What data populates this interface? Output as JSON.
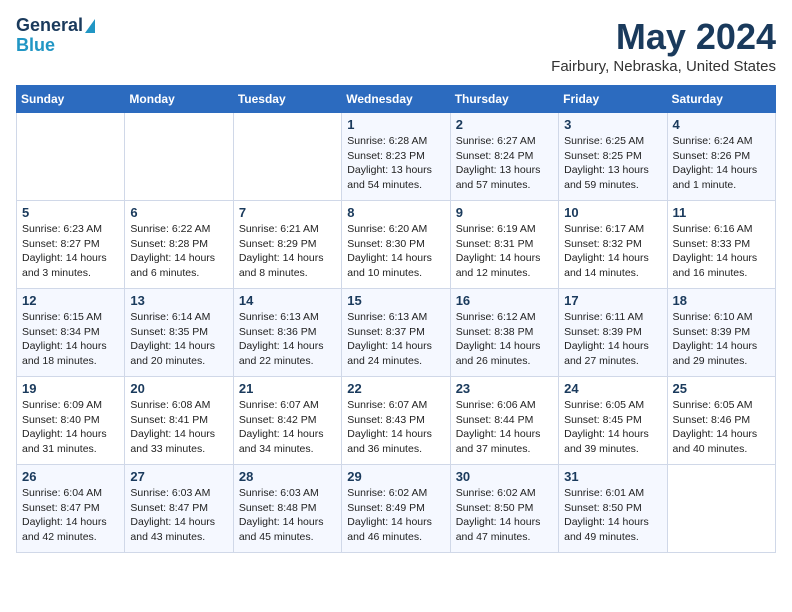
{
  "header": {
    "logo_line1": "General",
    "logo_line2": "Blue",
    "month": "May 2024",
    "location": "Fairbury, Nebraska, United States"
  },
  "weekdays": [
    "Sunday",
    "Monday",
    "Tuesday",
    "Wednesday",
    "Thursday",
    "Friday",
    "Saturday"
  ],
  "weeks": [
    [
      {
        "day": "",
        "info": ""
      },
      {
        "day": "",
        "info": ""
      },
      {
        "day": "",
        "info": ""
      },
      {
        "day": "1",
        "info": "Sunrise: 6:28 AM\nSunset: 8:23 PM\nDaylight: 13 hours\nand 54 minutes."
      },
      {
        "day": "2",
        "info": "Sunrise: 6:27 AM\nSunset: 8:24 PM\nDaylight: 13 hours\nand 57 minutes."
      },
      {
        "day": "3",
        "info": "Sunrise: 6:25 AM\nSunset: 8:25 PM\nDaylight: 13 hours\nand 59 minutes."
      },
      {
        "day": "4",
        "info": "Sunrise: 6:24 AM\nSunset: 8:26 PM\nDaylight: 14 hours\nand 1 minute."
      }
    ],
    [
      {
        "day": "5",
        "info": "Sunrise: 6:23 AM\nSunset: 8:27 PM\nDaylight: 14 hours\nand 3 minutes."
      },
      {
        "day": "6",
        "info": "Sunrise: 6:22 AM\nSunset: 8:28 PM\nDaylight: 14 hours\nand 6 minutes."
      },
      {
        "day": "7",
        "info": "Sunrise: 6:21 AM\nSunset: 8:29 PM\nDaylight: 14 hours\nand 8 minutes."
      },
      {
        "day": "8",
        "info": "Sunrise: 6:20 AM\nSunset: 8:30 PM\nDaylight: 14 hours\nand 10 minutes."
      },
      {
        "day": "9",
        "info": "Sunrise: 6:19 AM\nSunset: 8:31 PM\nDaylight: 14 hours\nand 12 minutes."
      },
      {
        "day": "10",
        "info": "Sunrise: 6:17 AM\nSunset: 8:32 PM\nDaylight: 14 hours\nand 14 minutes."
      },
      {
        "day": "11",
        "info": "Sunrise: 6:16 AM\nSunset: 8:33 PM\nDaylight: 14 hours\nand 16 minutes."
      }
    ],
    [
      {
        "day": "12",
        "info": "Sunrise: 6:15 AM\nSunset: 8:34 PM\nDaylight: 14 hours\nand 18 minutes."
      },
      {
        "day": "13",
        "info": "Sunrise: 6:14 AM\nSunset: 8:35 PM\nDaylight: 14 hours\nand 20 minutes."
      },
      {
        "day": "14",
        "info": "Sunrise: 6:13 AM\nSunset: 8:36 PM\nDaylight: 14 hours\nand 22 minutes."
      },
      {
        "day": "15",
        "info": "Sunrise: 6:13 AM\nSunset: 8:37 PM\nDaylight: 14 hours\nand 24 minutes."
      },
      {
        "day": "16",
        "info": "Sunrise: 6:12 AM\nSunset: 8:38 PM\nDaylight: 14 hours\nand 26 minutes."
      },
      {
        "day": "17",
        "info": "Sunrise: 6:11 AM\nSunset: 8:39 PM\nDaylight: 14 hours\nand 27 minutes."
      },
      {
        "day": "18",
        "info": "Sunrise: 6:10 AM\nSunset: 8:39 PM\nDaylight: 14 hours\nand 29 minutes."
      }
    ],
    [
      {
        "day": "19",
        "info": "Sunrise: 6:09 AM\nSunset: 8:40 PM\nDaylight: 14 hours\nand 31 minutes."
      },
      {
        "day": "20",
        "info": "Sunrise: 6:08 AM\nSunset: 8:41 PM\nDaylight: 14 hours\nand 33 minutes."
      },
      {
        "day": "21",
        "info": "Sunrise: 6:07 AM\nSunset: 8:42 PM\nDaylight: 14 hours\nand 34 minutes."
      },
      {
        "day": "22",
        "info": "Sunrise: 6:07 AM\nSunset: 8:43 PM\nDaylight: 14 hours\nand 36 minutes."
      },
      {
        "day": "23",
        "info": "Sunrise: 6:06 AM\nSunset: 8:44 PM\nDaylight: 14 hours\nand 37 minutes."
      },
      {
        "day": "24",
        "info": "Sunrise: 6:05 AM\nSunset: 8:45 PM\nDaylight: 14 hours\nand 39 minutes."
      },
      {
        "day": "25",
        "info": "Sunrise: 6:05 AM\nSunset: 8:46 PM\nDaylight: 14 hours\nand 40 minutes."
      }
    ],
    [
      {
        "day": "26",
        "info": "Sunrise: 6:04 AM\nSunset: 8:47 PM\nDaylight: 14 hours\nand 42 minutes."
      },
      {
        "day": "27",
        "info": "Sunrise: 6:03 AM\nSunset: 8:47 PM\nDaylight: 14 hours\nand 43 minutes."
      },
      {
        "day": "28",
        "info": "Sunrise: 6:03 AM\nSunset: 8:48 PM\nDaylight: 14 hours\nand 45 minutes."
      },
      {
        "day": "29",
        "info": "Sunrise: 6:02 AM\nSunset: 8:49 PM\nDaylight: 14 hours\nand 46 minutes."
      },
      {
        "day": "30",
        "info": "Sunrise: 6:02 AM\nSunset: 8:50 PM\nDaylight: 14 hours\nand 47 minutes."
      },
      {
        "day": "31",
        "info": "Sunrise: 6:01 AM\nSunset: 8:50 PM\nDaylight: 14 hours\nand 49 minutes."
      },
      {
        "day": "",
        "info": ""
      }
    ]
  ]
}
